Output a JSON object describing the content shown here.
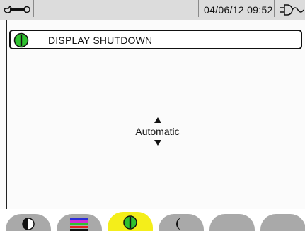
{
  "status_bar": {
    "datetime": "04/06/12  09:52",
    "left_icon": "wrench-icon",
    "right_icon": "power-plug-icon"
  },
  "header": {
    "title": "DISPLAY SHUTDOWN",
    "icon": "display-shutdown-icon"
  },
  "setting": {
    "value": "Automatic"
  },
  "tabs": [
    {
      "icon": "contrast-icon",
      "active": false
    },
    {
      "icon": "color-bars-icon",
      "active": false
    },
    {
      "icon": "display-shutdown-icon",
      "active": true
    },
    {
      "icon": "night-mode-icon",
      "active": false
    },
    {
      "icon": "",
      "active": false
    },
    {
      "icon": "",
      "active": false
    }
  ],
  "colors": {
    "active_tab": "#f4ee1a",
    "inactive_tab": "#a9a9a9",
    "shutdown_icon_green": "#2ec12e"
  }
}
